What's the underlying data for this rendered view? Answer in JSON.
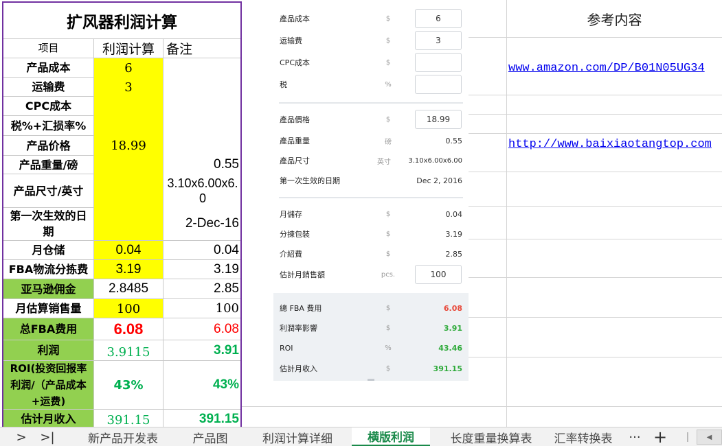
{
  "calc": {
    "title": "扩风器利润计算",
    "headers": {
      "item": "项目",
      "profit": "利润计算",
      "note": "备注"
    },
    "rows": {
      "cost": {
        "label": "产品成本",
        "value": "6",
        "note": ""
      },
      "shipping": {
        "label": "运输费",
        "value": "3",
        "note": ""
      },
      "cpc": {
        "label": "CPC成本",
        "value": "",
        "note": ""
      },
      "tax": {
        "label": "税%+汇损率%",
        "value": "",
        "note": ""
      },
      "price": {
        "label": "产品价格",
        "value": "18.99",
        "note": ""
      },
      "weight": {
        "label": "产品重量/磅",
        "value": "",
        "note": "0.55"
      },
      "size": {
        "label": "产品尺寸/英寸",
        "value": "",
        "note": "3.10x6.00x6.0"
      },
      "date": {
        "label": "第一次生效的日期",
        "value": "",
        "note": "2-Dec-16"
      },
      "storage": {
        "label": "月仓储",
        "value": "0.04",
        "note": "0.04"
      },
      "fba_pick": {
        "label": "FBA物流分拣费",
        "value": "3.19",
        "note": "3.19"
      },
      "commission": {
        "label": "亚马逊佣金",
        "value": "2.8485",
        "note": "2.85"
      },
      "monthly_sales": {
        "label": "月估算销售量",
        "value": "100",
        "note": "100"
      },
      "total_fba": {
        "label": "总FBA费用",
        "value": "6.08",
        "note": "6.08"
      },
      "profit": {
        "label": "利润",
        "value": "3.9115",
        "note": "3.91"
      },
      "roi": {
        "label": "ROI(投资回报率 利润/（产品成本+运费)",
        "value": "43%",
        "note": "43%"
      },
      "income": {
        "label": "估计月收入",
        "value": "391.15",
        "note": "391.15"
      }
    }
  },
  "panel": {
    "rows": {
      "cost": {
        "label": "產品成本",
        "unit": "$",
        "value": "6"
      },
      "shipping": {
        "label": "运输费",
        "unit": "$",
        "value": "3"
      },
      "cpc": {
        "label": "CPC成本",
        "unit": "$",
        "value": ""
      },
      "tax": {
        "label": "税",
        "unit": "%",
        "value": ""
      },
      "price": {
        "label": "產品價格",
        "unit": "$",
        "value": "18.99"
      },
      "weight": {
        "label": "產品重量",
        "unit": "磅",
        "value": "0.55"
      },
      "size": {
        "label": "產品尺寸",
        "unit": "英寸",
        "value": "3.10x6.00x6.00"
      },
      "date": {
        "label": "第一次生效的日期",
        "unit": "",
        "value": "Dec 2, 2016"
      },
      "storage": {
        "label": "月儲存",
        "unit": "$",
        "value": "0.04"
      },
      "pick": {
        "label": "分揀包裝",
        "unit": "$",
        "value": "3.19"
      },
      "referral": {
        "label": "介紹費",
        "unit": "$",
        "value": "2.85"
      },
      "sales": {
        "label": "估計月銷售額",
        "unit": "pcs.",
        "value": "100"
      },
      "total_fba": {
        "label": "總 FBA 費用",
        "unit": "$",
        "value": "6.08"
      },
      "margin": {
        "label": "利潤率影響",
        "unit": "$",
        "value": "3.91"
      },
      "roi": {
        "label": "ROI",
        "unit": "%",
        "value": "43.46"
      },
      "income": {
        "label": "估計月收入",
        "unit": "$",
        "value": "391.15"
      }
    }
  },
  "reference": {
    "title": "参考内容",
    "links": [
      "www.amazon.com/DP/B01N05UG34",
      "http://www.baixiaotangtop.com"
    ]
  },
  "tabs": {
    "next_icon": ">",
    "last_icon": ">|",
    "items": [
      "新产品开发表",
      "产品图",
      "利润计算详细",
      "横版利润",
      "长度重量换算表",
      "汇率转换表"
    ],
    "more": "···",
    "add": "+"
  },
  "colors": {
    "accent_border": "#7030a0",
    "yellow_fill": "#ffff00",
    "green_fill": "#92d050",
    "red_text": "#ff0000",
    "green_text": "#00b050",
    "panel_red": "#e84b3c",
    "panel_green": "#2eaa3a",
    "active_tab": "#1a8a4a"
  }
}
